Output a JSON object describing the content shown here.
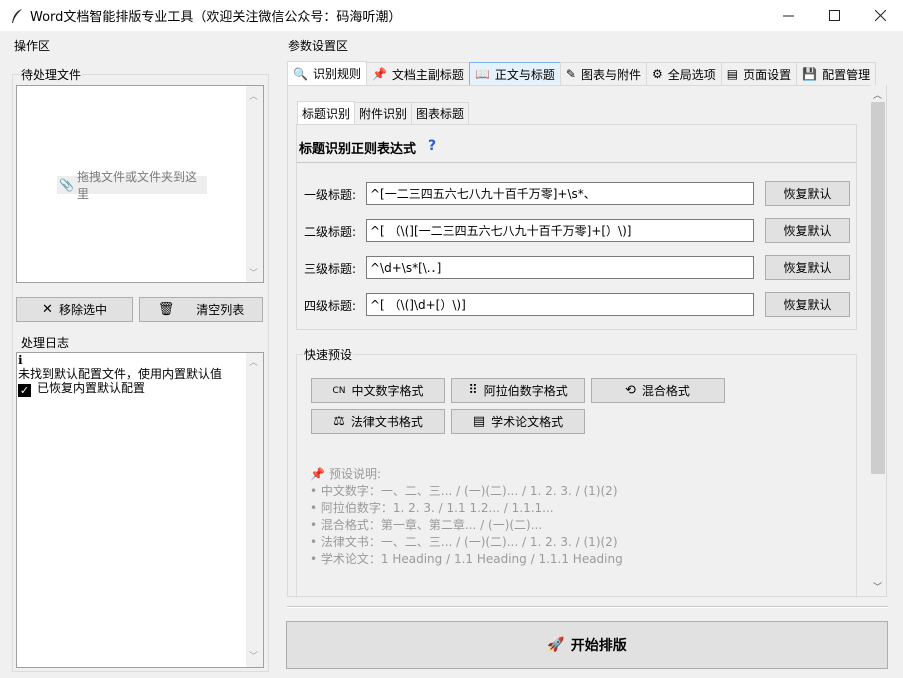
{
  "window": {
    "title": "Word文档智能排版专业工具（欢迎关注微信公众号：码海听潮）",
    "icons": {
      "app": "feather-icon",
      "minimize": "minimize-icon",
      "maximize": "maximize-icon",
      "close": "close-icon"
    }
  },
  "left": {
    "section_label": "操作区",
    "pending_label": "待处理文件",
    "drop_hint": "拖拽文件或文件夹到这里",
    "remove_button": "移除选中",
    "clear_button": "清空列表",
    "log_label": "处理日志",
    "log_lines": [
      {
        "icon": "info-icon",
        "text": "ℹ"
      },
      {
        "icon": "",
        "text": "未找到默认配置文件，使用内置默认值"
      },
      {
        "icon": "check-icon",
        "text": "已恢复内置默认配置"
      }
    ]
  },
  "right": {
    "section_label": "参数设置区",
    "tabs": [
      {
        "icon": "search-icon",
        "label": "识别规则",
        "active": true
      },
      {
        "icon": "pin-icon",
        "label": "文档主副标题"
      },
      {
        "icon": "book-icon",
        "label": "正文与标题"
      },
      {
        "icon": "pen-icon",
        "label": "图表与附件"
      },
      {
        "icon": "gear-icon",
        "label": "全局选项"
      },
      {
        "icon": "page-icon",
        "label": "页面设置"
      },
      {
        "icon": "save-icon",
        "label": "配置管理"
      }
    ],
    "subtabs": [
      {
        "label": "标题识别",
        "active": true
      },
      {
        "label": "附件识别"
      },
      {
        "label": "图表标题"
      }
    ],
    "regex_title": "标题识别正则表达式",
    "help_glyph": "?",
    "rows": [
      {
        "label": "一级标题:",
        "value": "^[一二三四五六七八九十百千万零]+\\s*、",
        "button": "恢复默认"
      },
      {
        "label": "二级标题:",
        "value": "^[ （\\(][一二三四五六七八九十百千万零]+[）\\)]",
        "button": "恢复默认"
      },
      {
        "label": "三级标题:",
        "value": "^\\d+\\s*[\\.．]",
        "button": "恢复默认"
      },
      {
        "label": "四级标题:",
        "value": "^[ （\\(]\\d+[）\\)]",
        "button": "恢复默认"
      }
    ],
    "preset_label": "快速预设",
    "presets": [
      {
        "icon": "cn-icon",
        "glyph": "CN",
        "label": "中文数字格式"
      },
      {
        "icon": "number-grid-icon",
        "glyph": "⠿",
        "label": "阿拉伯数字格式"
      },
      {
        "icon": "mixed-icon",
        "glyph": "⟲",
        "label": "混合格式"
      },
      {
        "icon": "scales-icon",
        "glyph": "⚖",
        "label": "法律文书格式"
      },
      {
        "icon": "register-icon",
        "glyph": "▤",
        "label": "学术论文格式"
      }
    ],
    "notes_title": "预设说明:",
    "notes": [
      "• 中文数字：一、二、三... / (一)(二)... / 1. 2. 3. / (1)(2)",
      "• 阿拉伯数字：1. 2. 3. / 1.1 1.2... / 1.1.1...",
      "• 混合格式：第一章、第二章... / (一)(二)...",
      "• 法律文书：一、二、三... / (一)(二)... / 1. 2. 3. / (1)(2)",
      "• 学术论文：1 Heading / 1.1 Heading / 1.1.1 Heading"
    ],
    "start_button": "开始排版"
  }
}
